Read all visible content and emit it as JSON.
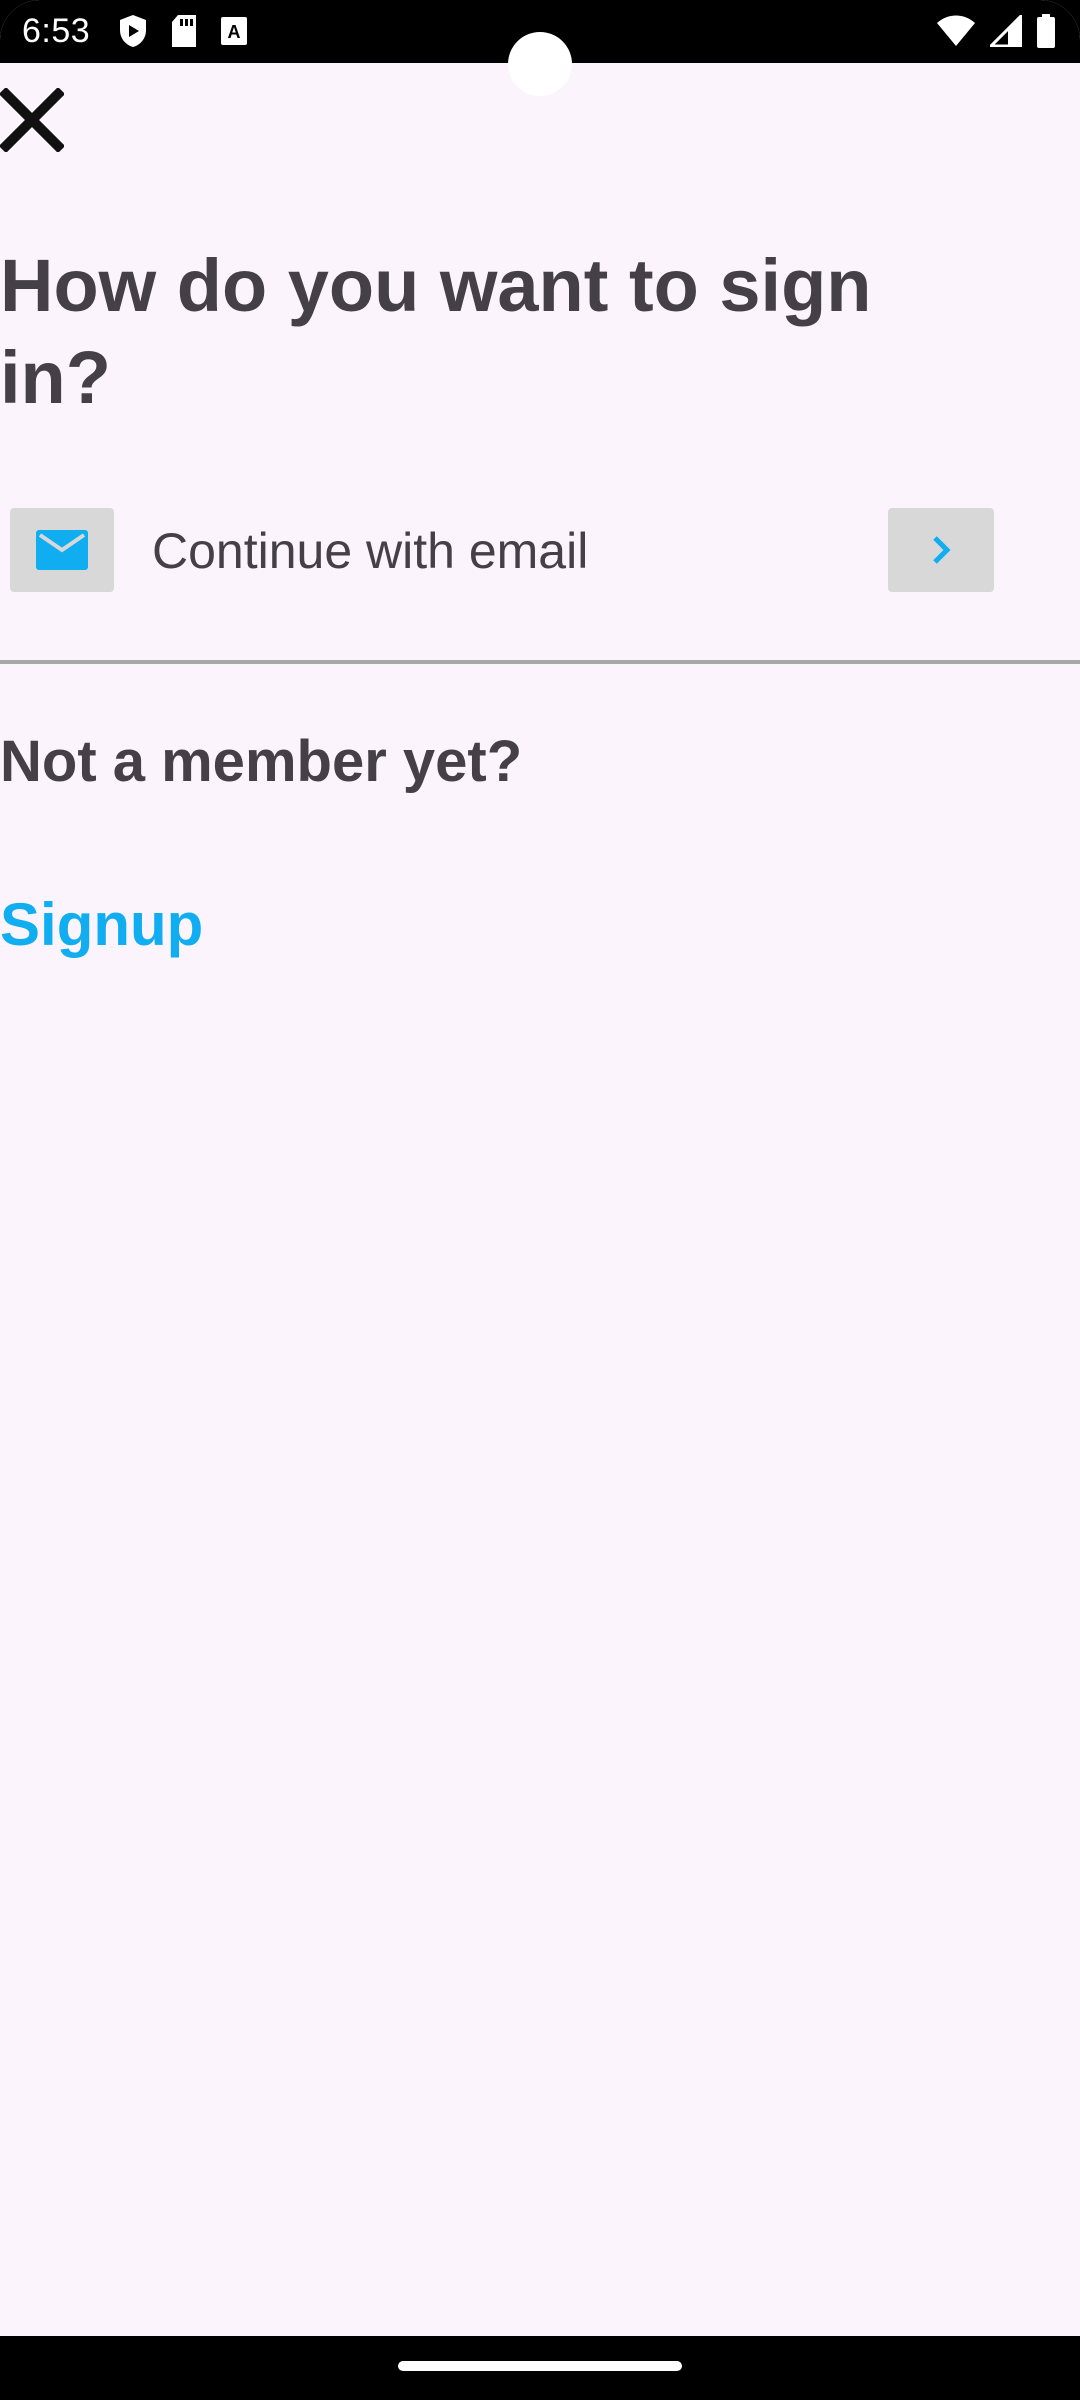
{
  "status_bar": {
    "time": "6:53",
    "icons_left": [
      "play-protect-icon",
      "sd-card-icon",
      "keyboard-a-icon"
    ],
    "icons_right": [
      "wifi-icon",
      "signal-icon",
      "battery-icon"
    ]
  },
  "close": {
    "icon": "close-icon"
  },
  "title": "How do you want to sign in?",
  "email_option": {
    "label": "Continue with email",
    "icon": "mail-icon",
    "arrow_icon": "chevron-right-icon"
  },
  "signup_section": {
    "prompt": "Not a member yet?",
    "link": "Signup"
  },
  "colors": {
    "background": "#fcf4fc",
    "text": "#454048",
    "accent": "#10aef0",
    "icon_box": "#d8d8d8",
    "divider": "#a8a8a8"
  }
}
